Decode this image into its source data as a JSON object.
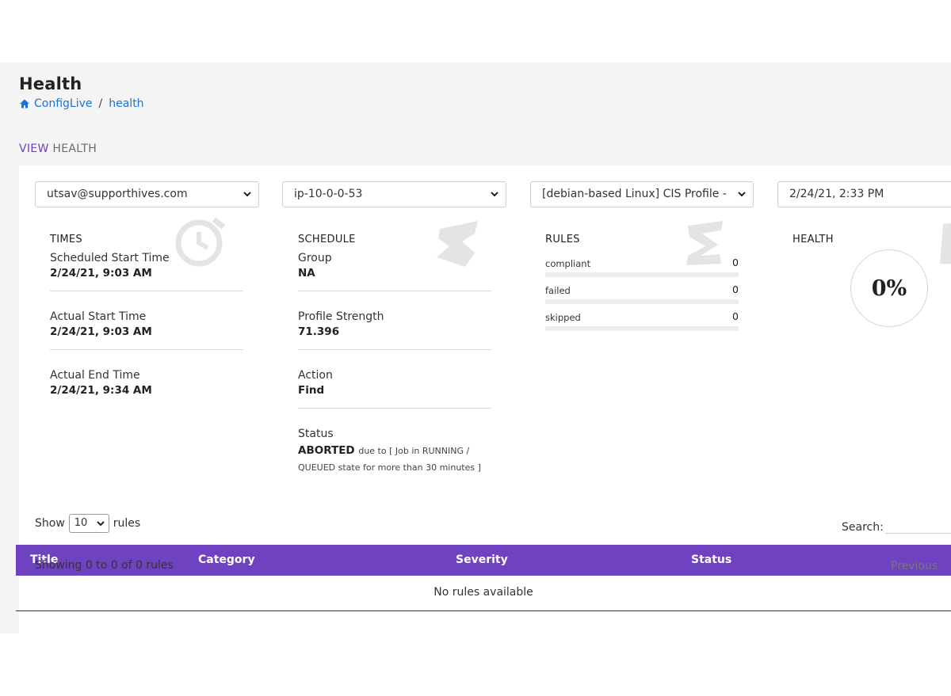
{
  "header": {
    "title": "Health",
    "breadcrumb": {
      "home_label": "ConfigLive",
      "separator": "/",
      "current": "health"
    }
  },
  "view_heading": {
    "accent": "VIEW",
    "rest": "HEALTH"
  },
  "filters": {
    "user": "utsav@supporthives.com",
    "host": "ip-10-0-0-53",
    "profile": "[debian-based Linux] CIS Profile - ",
    "datetime": "2/24/21, 2:33 PM"
  },
  "times": {
    "title": "TIMES",
    "scheduled_start_label": "Scheduled Start Time",
    "scheduled_start_value": "2/24/21, 9:03 AM",
    "actual_start_label": "Actual Start Time",
    "actual_start_value": "2/24/21, 9:03 AM",
    "actual_end_label": "Actual End Time",
    "actual_end_value": "2/24/21, 9:34 AM"
  },
  "schedule": {
    "title": "SCHEDULE",
    "group_label": "Group",
    "group_value": "NA",
    "strength_label": "Profile Strength",
    "strength_value": "71.396",
    "action_label": "Action",
    "action_value": "Find",
    "status_label": "Status",
    "status_value": "ABORTED",
    "status_note": "due to [ Job in RUNNING / QUEUED state for more than 30 minutes ]"
  },
  "rules": {
    "title": "RULES",
    "items": [
      {
        "label": "compliant",
        "value": "0"
      },
      {
        "label": "failed",
        "value": "0"
      },
      {
        "label": "skipped",
        "value": "0"
      }
    ]
  },
  "health": {
    "title": "HEALTH",
    "percent": "0%"
  },
  "table_controls": {
    "show_label": "Show",
    "page_size": "10",
    "rules_label": "rules",
    "search_label": "Search:"
  },
  "table": {
    "columns": [
      "Title",
      "Category",
      "Severity",
      "Status"
    ],
    "empty_message": "No rules available",
    "info": "Showing 0 to 0 of 0 rules",
    "previous": "Previous"
  },
  "colors": {
    "accent": "#6f42c1",
    "link": "#1a73d9",
    "background": "#f4f4f4"
  }
}
